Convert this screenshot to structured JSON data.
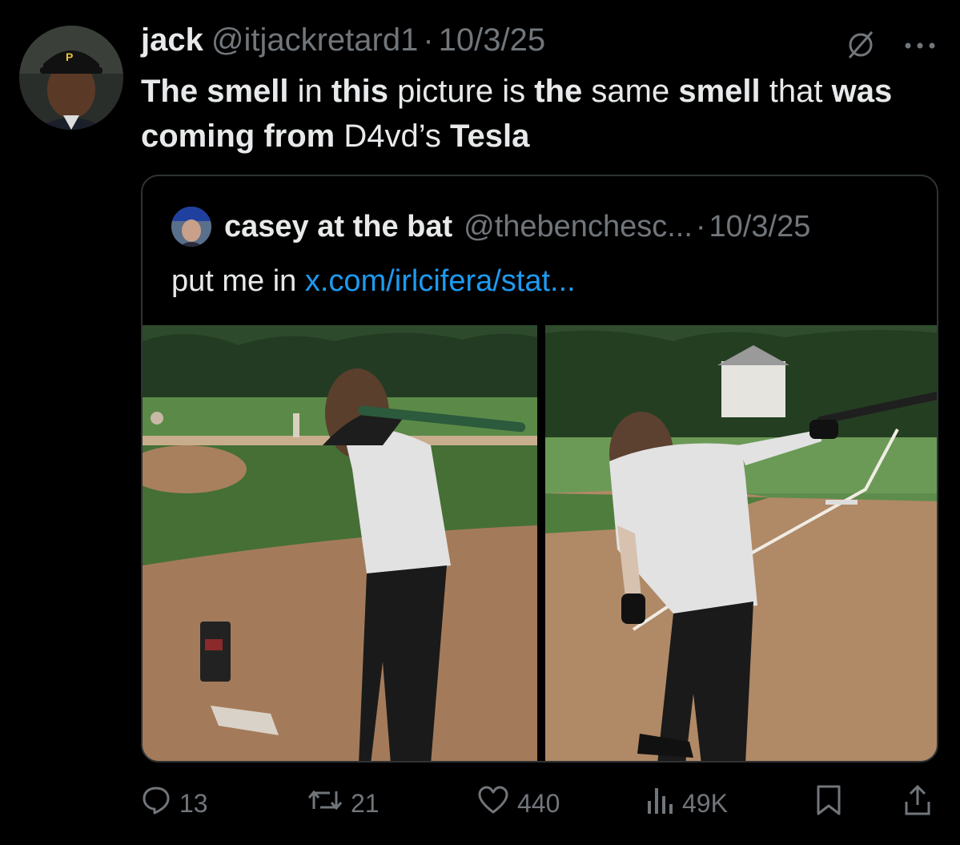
{
  "tweet": {
    "author_name": "jack",
    "author_handle": "@itjackretard1",
    "separator": "·",
    "date": "10/3/25",
    "text_segments": [
      {
        "text": "The smell",
        "bold": true
      },
      {
        "text": " in ",
        "bold": false
      },
      {
        "text": "this",
        "bold": true
      },
      {
        "text": " picture is ",
        "bold": false
      },
      {
        "text": "the",
        "bold": true
      },
      {
        "text": " same ",
        "bold": false
      },
      {
        "text": "smell",
        "bold": true
      },
      {
        "text": " that ",
        "bold": false
      },
      {
        "text": "was coming from",
        "bold": true
      },
      {
        "text": " D4vd’s ",
        "bold": false
      },
      {
        "text": "Tesla",
        "bold": true
      }
    ]
  },
  "quoted": {
    "author_name": "casey at the bat",
    "author_handle": "@thebenchesc...",
    "separator": "·",
    "date": "10/3/25",
    "text": "put me in ",
    "link": "x.com/irlcifera/stat..."
  },
  "actions": {
    "replies": "13",
    "reposts": "21",
    "likes": "440",
    "views": "49K"
  },
  "icons": {
    "header": [
      "grok-icon",
      "more-icon"
    ],
    "actions": [
      "reply-icon",
      "repost-icon",
      "like-icon",
      "views-icon",
      "bookmark-icon",
      "share-icon"
    ]
  },
  "colors": {
    "background": "#000000",
    "text_primary": "#e7e9ea",
    "text_secondary": "#71767b",
    "link": "#1d9bf0",
    "border": "#2f3336"
  }
}
